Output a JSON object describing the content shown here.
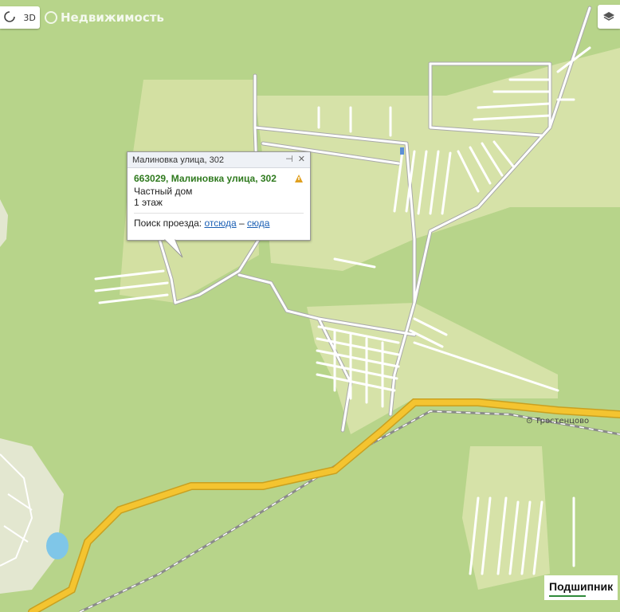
{
  "controls": {
    "three_d": "3D",
    "spinner_icon": "spinner-icon",
    "layers_icon": "layers-icon"
  },
  "brand": {
    "label": "Недвижимость"
  },
  "balloon": {
    "header": "Малиновка улица, 302",
    "address": "663029, Малиновка улица, 302",
    "type": "Частный дом",
    "floors": "1 этаж",
    "route_label": "Поиск проезда:",
    "from_link": "отсюда",
    "dash": "–",
    "to_link": "сюда"
  },
  "labels": {
    "village": "Тростенцово",
    "station": "Подшипник"
  },
  "colors": {
    "forest": "#b7d48a",
    "field": "#d6e2a8",
    "highway": "#f4c430",
    "railway": "#9a9a9a"
  }
}
